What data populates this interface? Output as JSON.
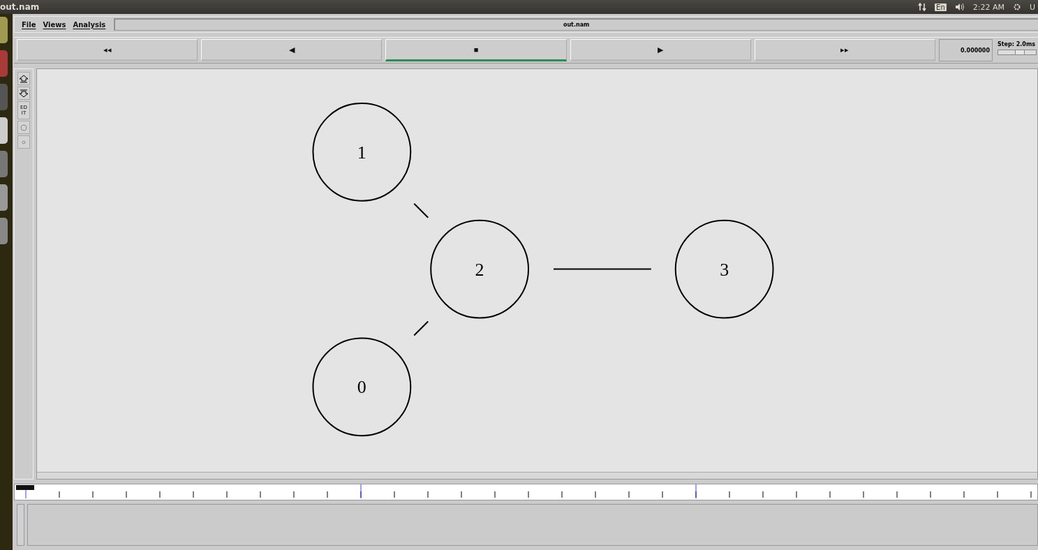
{
  "top_bar": {
    "title": "out.nam",
    "keyboard": "En",
    "clock": "2:22 AM",
    "user": "U"
  },
  "menu": [
    "File",
    "Views",
    "Analysis"
  ],
  "window_title": "out.nam",
  "transport": [
    {
      "symbol": "◂◂",
      "selected": false
    },
    {
      "symbol": "◀",
      "selected": false
    },
    {
      "symbol": "■",
      "selected": true
    },
    {
      "symbol": "▶",
      "selected": false
    },
    {
      "symbol": "▸▸",
      "selected": false
    }
  ],
  "time": "0.000000",
  "step": {
    "label": "Step: 2.0ms",
    "level": 0.55
  },
  "tools": [
    {
      "kind": "zoom-in"
    },
    {
      "kind": "zoom-out"
    },
    {
      "kind": "edit",
      "label": "ED IT"
    },
    {
      "kind": "circle"
    },
    {
      "kind": "dot"
    }
  ],
  "nodes": [
    {
      "label": "1"
    },
    {
      "label": "2"
    },
    {
      "label": "3"
    },
    {
      "label": "0"
    }
  ]
}
